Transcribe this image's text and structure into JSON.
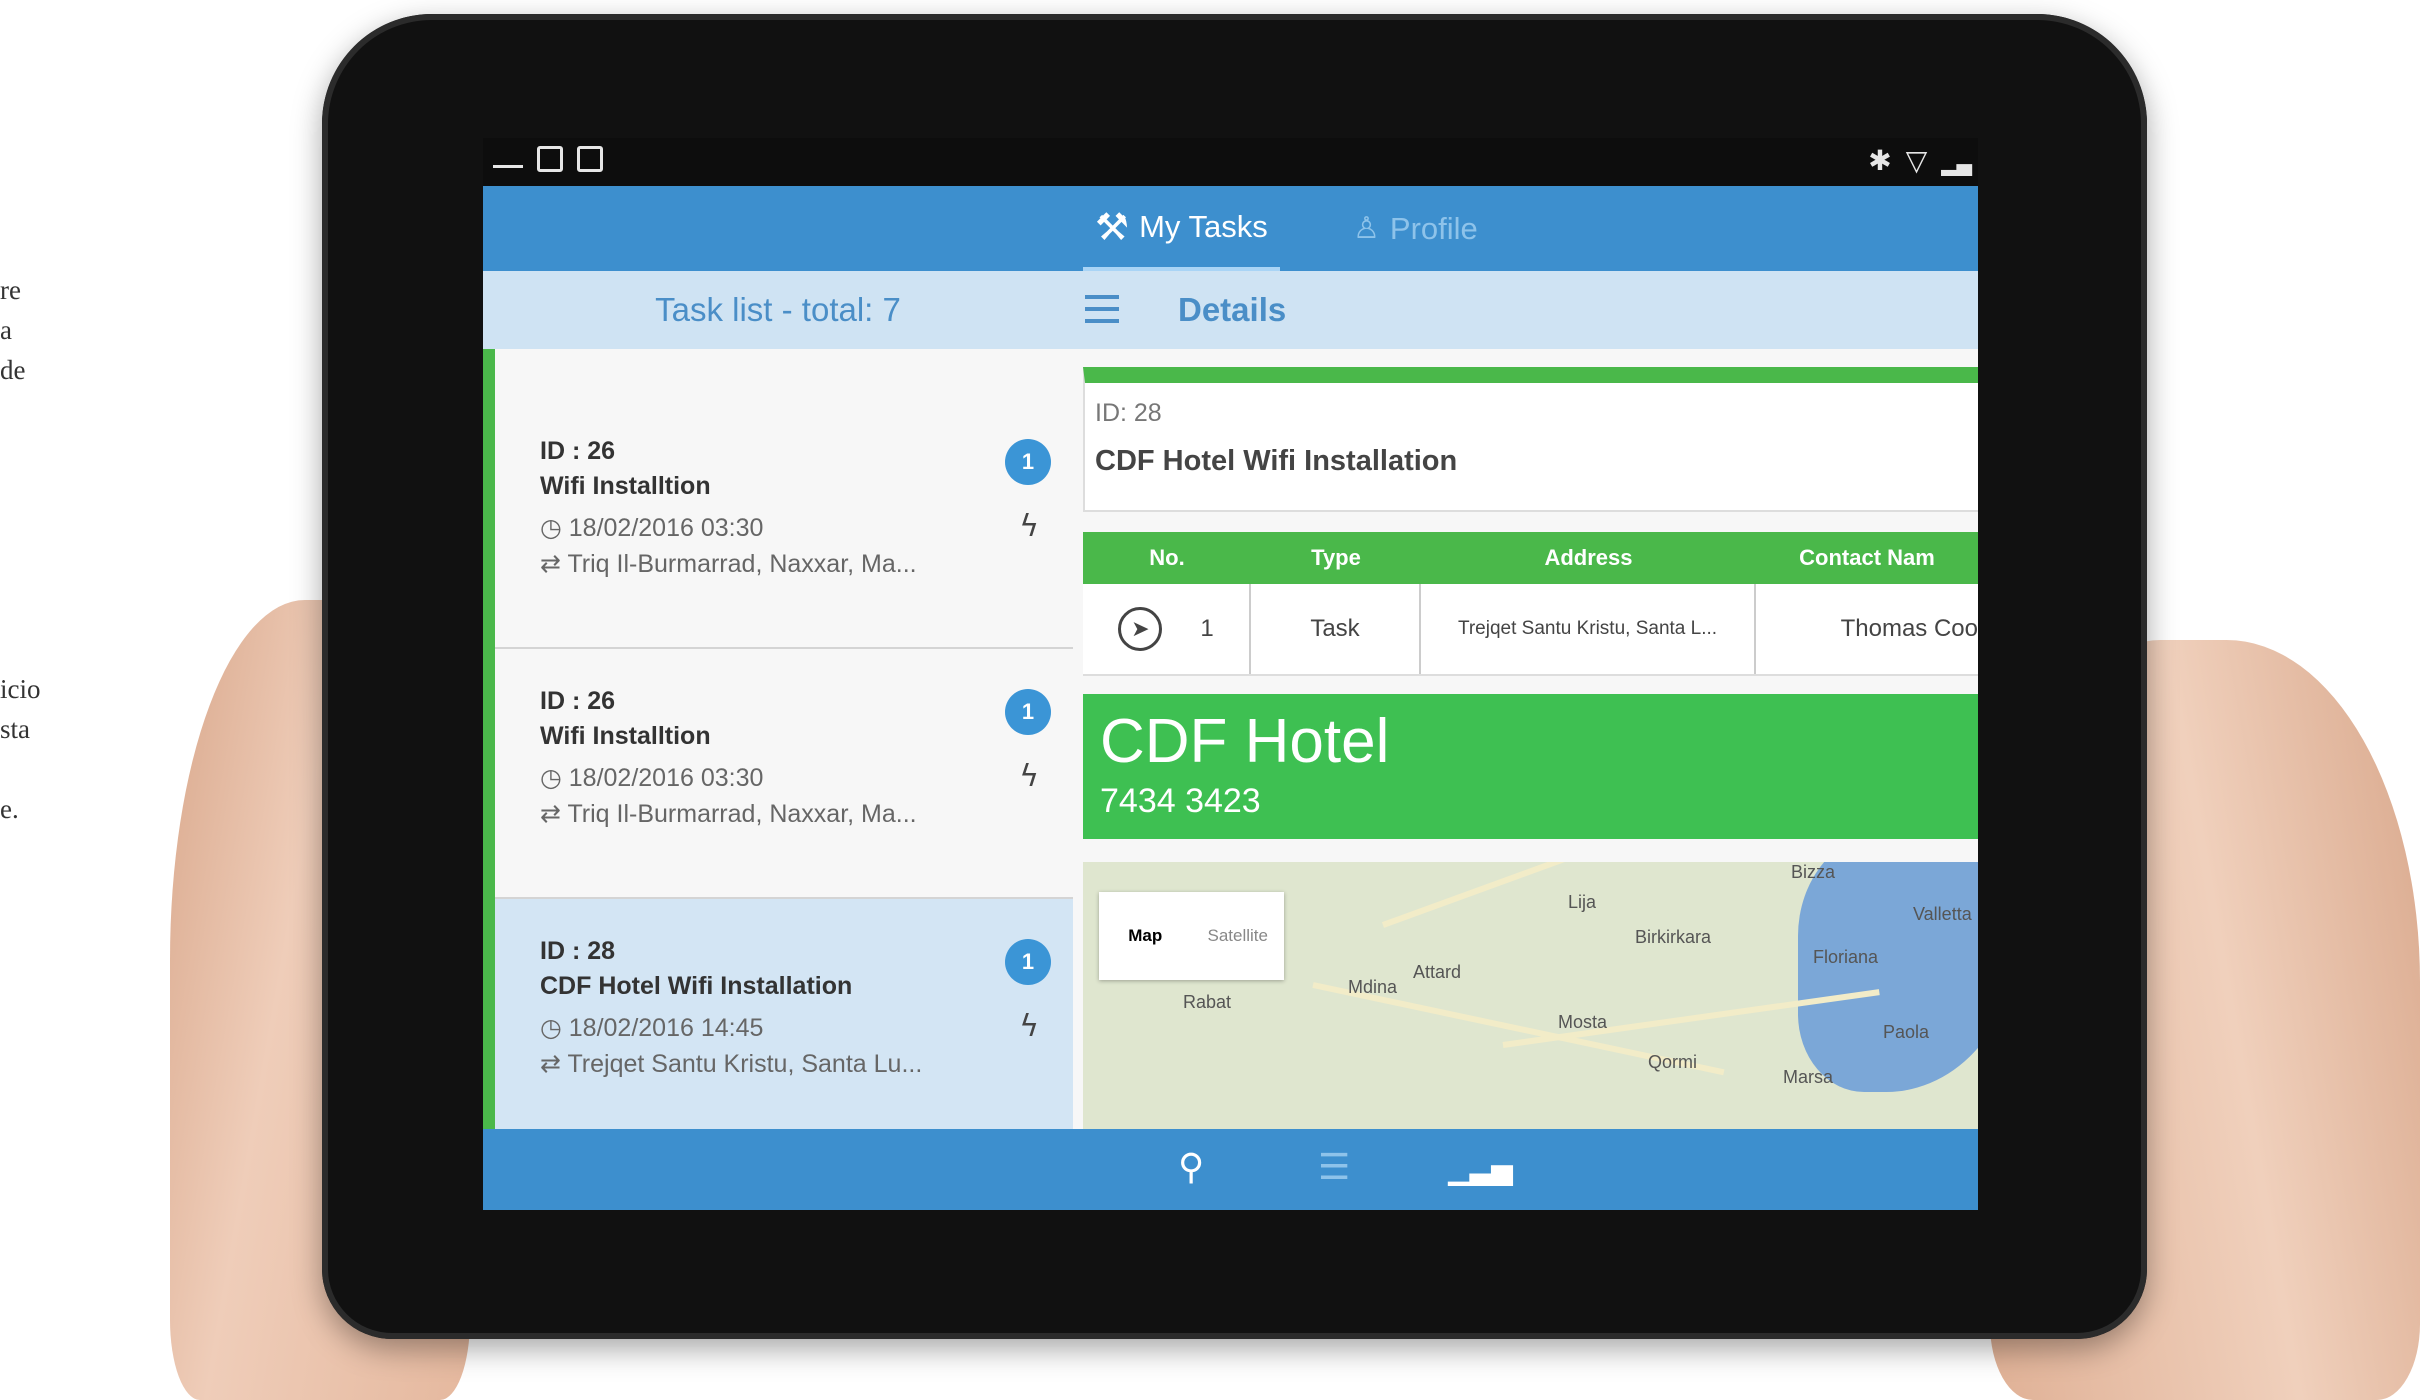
{
  "edge_text": {
    "line1": "re",
    "line2": "a",
    "line3": "de",
    "line4": "icio",
    "line5": "sta",
    "line6": "e."
  },
  "status_bar": {
    "left_icons": [
      "screen-cast-icon",
      "document-icon",
      "image-icon"
    ],
    "right_icons": [
      "bluetooth-icon",
      "wifi-icon",
      "signal-icon"
    ]
  },
  "tabs": [
    {
      "label": "My Tasks",
      "icon": "tools-icon",
      "active": true
    },
    {
      "label": "Profile",
      "icon": "person-icon",
      "active": false
    }
  ],
  "task_list": {
    "header": "Task list - total: 7",
    "items": [
      {
        "id": "ID : 26",
        "title": "Wifi Installtion",
        "date": "18/02/2016 03:30",
        "address": "Triq Il-Burmarrad, Naxxar, Ma...",
        "badge": "1",
        "selected": false
      },
      {
        "id": "ID : 26",
        "title": "Wifi Installtion",
        "date": "18/02/2016 03:30",
        "address": "Triq Il-Burmarrad, Naxxar, Ma...",
        "badge": "1",
        "selected": false
      },
      {
        "id": "ID : 28",
        "title": "CDF Hotel Wifi Installation",
        "date": "18/02/2016 14:45",
        "address": "Trejqet Santu Kristu, Santa Lu...",
        "badge": "1",
        "selected": true
      }
    ]
  },
  "details": {
    "header": "Details",
    "id": "ID: 28",
    "title": "CDF Hotel Wifi Installation",
    "table": {
      "columns": [
        "No.",
        "Type",
        "Address",
        "Contact Nam"
      ],
      "rows": [
        {
          "no": "1",
          "type": "Task",
          "address": "Trejqet Santu Kristu, Santa L...",
          "contact": "Thomas Coo"
        }
      ]
    },
    "contact_name": "CDF Hotel",
    "contact_phone": "7434 3423",
    "map": {
      "toggle_map": "Map",
      "toggle_satellite": "Satellite",
      "labels": [
        "Lija",
        "Birkirkara",
        "Valletta",
        "Floriana",
        "Attard",
        "Mdina",
        "Rabat",
        "Mosta",
        "Qormi",
        "Marsa",
        "Paola",
        "Bizza"
      ]
    }
  },
  "bottom_bar": {
    "icons": [
      "search-icon",
      "filter-icon",
      "stats-icon"
    ]
  },
  "colors": {
    "primary_blue": "#3d8fce",
    "accent_green": "#3ec052",
    "header_light_blue": "#cfe3f3",
    "badge_blue": "#3b95d6"
  }
}
